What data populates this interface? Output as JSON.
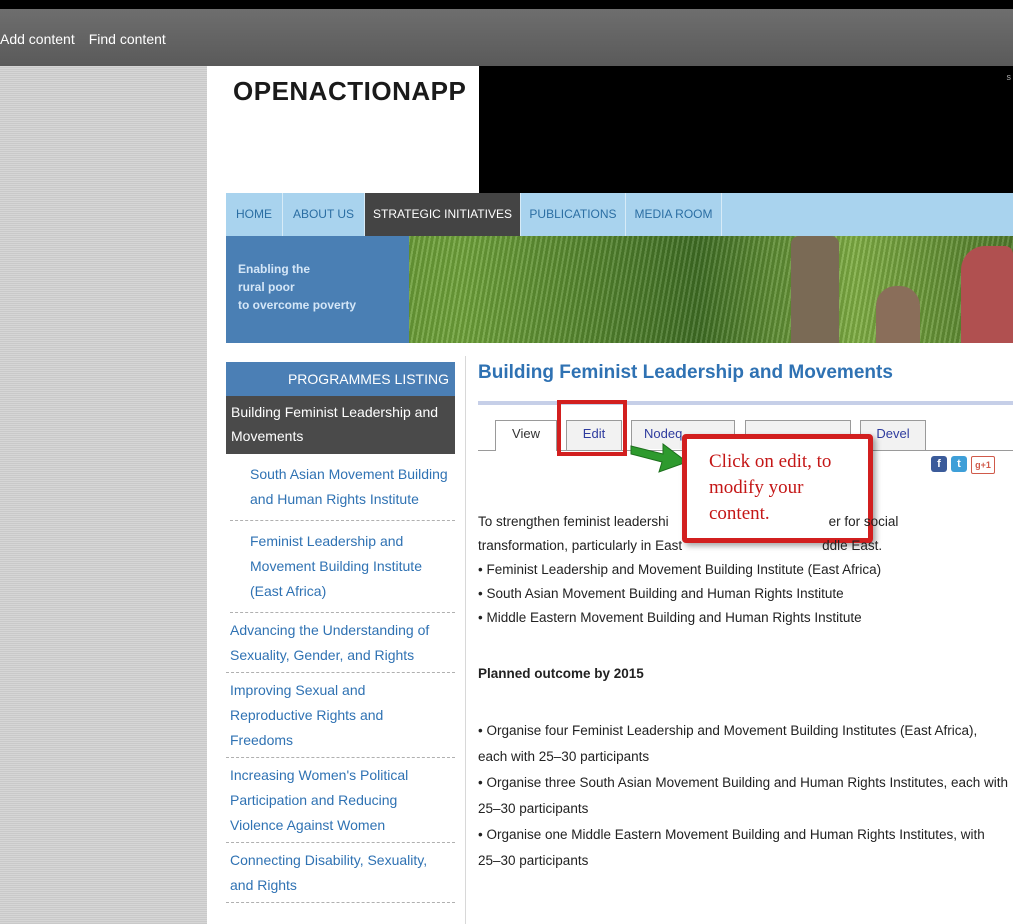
{
  "admin_bar": {
    "add_content": "Add content",
    "find_content": "Find content"
  },
  "header": {
    "site_name": "OPENACTIONAPP",
    "corner_text": "s"
  },
  "nav": {
    "items": [
      "HOME",
      "ABOUT US",
      "STRATEGIC INITIATIVES",
      "PUBLICATIONS",
      "MEDIA ROOM"
    ],
    "active": "STRATEGIC INITIATIVES"
  },
  "banner": {
    "line1": "Enabling the",
    "line2": "rural poor",
    "line3": "to overcome poverty"
  },
  "sidebar": {
    "heading": "PROGRAMMES LISTING",
    "active_item": "Building Feminist Leadership and Movements",
    "sub_items": [
      "South Asian Movement Building and Human Rights Institute",
      "Feminist Leadership and Movement Building Institute (East Africa)"
    ],
    "items": [
      "Advancing the Understanding of Sexuality, Gender, and Rights",
      "Improving Sexual and Reproductive Rights and Freedoms",
      "Increasing Women's Political Participation and Reducing Violence Against Women",
      "Connecting Disability, Sexuality, and Rights"
    ]
  },
  "content": {
    "title": "Building Feminist Leadership and Movements",
    "tabs": {
      "view": "View",
      "edit": "Edit",
      "nodequeue": "Nodeq",
      "devel": "Devel"
    },
    "callout": {
      "line1": "Click on edit, to",
      "line2": "modify your",
      "line3": "content."
    },
    "social": {
      "facebook": "f",
      "twitter": "t",
      "gplus": "g+1"
    },
    "intro_line1": "To strengthen feminist leadershi",
    "intro_line1_end": "er for social",
    "intro_line2": "transformation, particularly in East",
    "intro_line2_end": "ddle East.",
    "bullets": [
      "• Feminist Leadership and Movement Building Institute (East Africa)",
      "• South Asian Movement Building and Human Rights Institute",
      "• Middle Eastern Movement Building and Human Rights Institute"
    ],
    "planned_heading": "Planned outcome by 2015",
    "outcomes": [
      "• Organise four Feminist Leadership and Movement Building Institutes (East Africa), each with 25–30 participants",
      "• Organise three South Asian Movement Building and Human Rights Institutes, each with 25–30 participants",
      "• Organise one Middle Eastern Movement Building and Human Rights Institutes, with 25–30 participants"
    ]
  }
}
